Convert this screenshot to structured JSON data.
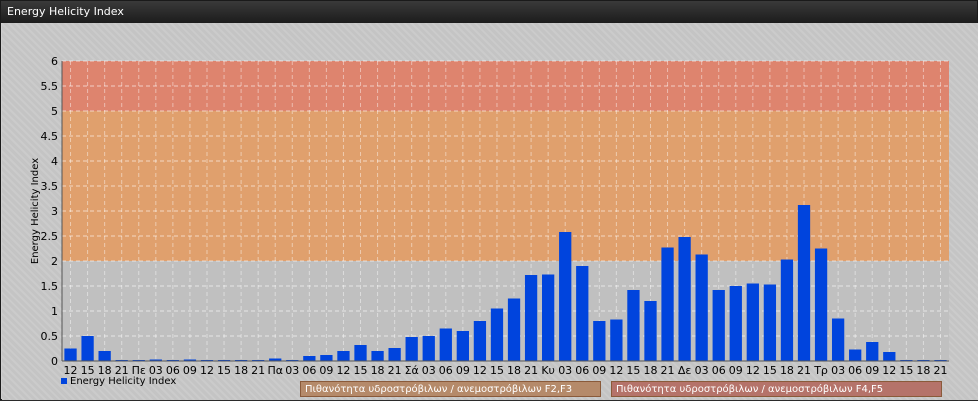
{
  "window": {
    "title": "Energy Helicity Index"
  },
  "chart_data": {
    "type": "bar",
    "ylabel": "Energy Helicity Index",
    "ylim": [
      0,
      6
    ],
    "yticks": [
      "0",
      "0.5",
      "1",
      "1.5",
      "2",
      "2.5",
      "3",
      "3.5",
      "4",
      "4.5",
      "5",
      "5.5",
      "6"
    ],
    "grid": true,
    "categories": [
      "12",
      "15",
      "18",
      "21",
      "Πε",
      "03",
      "06",
      "09",
      "12",
      "15",
      "18",
      "21",
      "Πα",
      "03",
      "06",
      "09",
      "12",
      "15",
      "18",
      "21",
      "Σά",
      "03",
      "06",
      "09",
      "12",
      "15",
      "18",
      "21",
      "Κυ",
      "03",
      "06",
      "09",
      "12",
      "15",
      "18",
      "21",
      "Δε",
      "03",
      "06",
      "09",
      "12",
      "15",
      "18",
      "21",
      "Τρ",
      "03",
      "06",
      "09",
      "12",
      "15",
      "18",
      "21"
    ],
    "series": [
      {
        "name": "Energy Helicity Index",
        "color": "#0044dd",
        "values": [
          0.25,
          0.5,
          0.2,
          0.02,
          0.02,
          0.03,
          0.02,
          0.03,
          0.02,
          0.02,
          0.02,
          0.02,
          0.05,
          0.02,
          0.1,
          0.12,
          0.2,
          0.32,
          0.2,
          0.26,
          0.48,
          0.5,
          0.65,
          0.6,
          0.8,
          1.05,
          1.25,
          1.72,
          1.73,
          2.58,
          1.9,
          0.8,
          0.83,
          1.42,
          1.2,
          2.27,
          2.48,
          2.13,
          1.42,
          1.5,
          1.55,
          1.53,
          2.03,
          3.12,
          2.25,
          0.85,
          0.23,
          0.38,
          0.18,
          0.02,
          0.02,
          0.02
        ]
      }
    ],
    "bands": [
      {
        "from": 2,
        "to": 5,
        "color": "#e59a5e",
        "label": "Πιθανότητα υδροστρόβιλων / ανεμοστρόβιλων F2,F3"
      },
      {
        "from": 5,
        "to": 6,
        "color": "#e3795f",
        "label": "Πιθανότητα υδροστρόβιλων / ανεμοστρόβιλων F4,F5"
      }
    ],
    "legend": "bottom"
  }
}
